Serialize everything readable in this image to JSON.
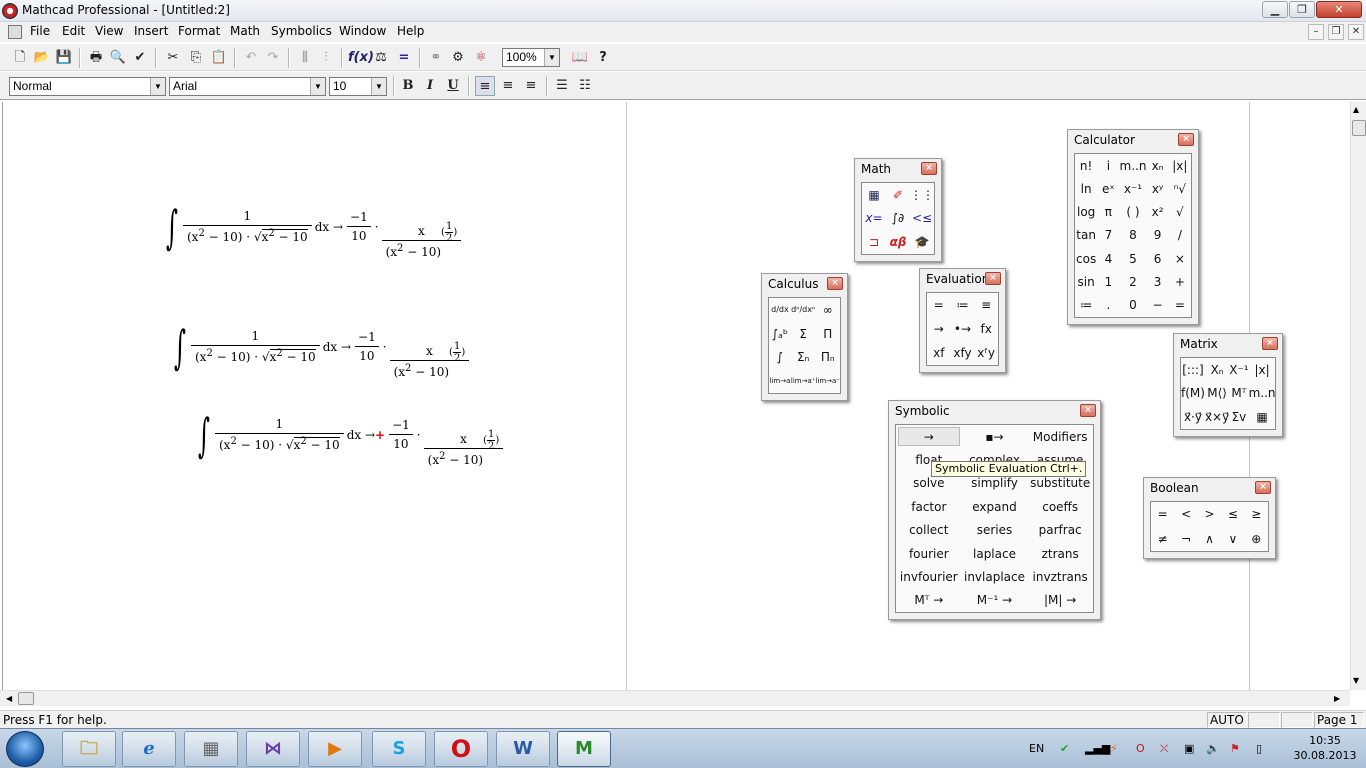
{
  "window": {
    "title": "Mathcad Professional - [Untitled:2]",
    "min": "▁",
    "max": "❐",
    "close": "✕",
    "mdi_min": "–",
    "mdi_max": "❐",
    "mdi_close": "✕"
  },
  "menu": [
    "File",
    "Edit",
    "View",
    "Insert",
    "Format",
    "Math",
    "Symbolics",
    "Window",
    "Help"
  ],
  "toolbar": {
    "zoom": "100%"
  },
  "format_bar": {
    "style": "Normal",
    "font": "Arial",
    "size": "10",
    "bold": "B",
    "italic": "I",
    "underline": "U"
  },
  "worksheet": {
    "expressions": [
      {
        "num": "1",
        "den_a": "x",
        "den_a_exp": "2",
        "den_b": " − 10",
        "dot": "·",
        "sqrt": "√",
        "rad_x": "x",
        "rad_exp": "2",
        "rad_rest": " − 10",
        "dx": "dx",
        "arrow": "→",
        "rnum": "−1",
        "rden": "10",
        "rdot": "·",
        "fnum": "x",
        "fden_x": "x",
        "fden_exp": "2",
        "fden_rest": " − 10",
        "pnum": "1",
        "pden": "2"
      },
      {
        "num": "1",
        "den_a": "x",
        "den_a_exp": "2",
        "den_b": " − 10",
        "dot": "·",
        "sqrt": "√",
        "rad_x": "x",
        "rad_exp": "2",
        "rad_rest": " − 10",
        "dx": "dx",
        "arrow": "→",
        "rnum": "−1",
        "rden": "10",
        "rdot": "·",
        "fnum": "x",
        "fden_x": "x",
        "fden_exp": "2",
        "fden_rest": " − 10",
        "pnum": "1",
        "pden": "2"
      },
      {
        "num": "1",
        "den_a": "x",
        "den_a_exp": "2",
        "den_b": " − 10",
        "dot": "·",
        "sqrt": "√",
        "rad_x": "x",
        "rad_exp": "2",
        "rad_rest": " − 10",
        "dx": "dx",
        "arrow": "→",
        "rnum": "−1",
        "rden": "10",
        "rdot": "·",
        "fnum": "x",
        "fden_x": "x",
        "fden_exp": "2",
        "fden_rest": " − 10",
        "pnum": "1",
        "pden": "2"
      }
    ]
  },
  "palettes": {
    "math": {
      "title": "Math",
      "close": "×",
      "items": [
        "▦",
        "✐",
        "⋮⋮",
        "x=",
        "∫∂",
        "<≤",
        "⊐",
        "αβ",
        "🎓"
      ]
    },
    "calculus": {
      "title": "Calculus",
      "close": "×",
      "items": [
        "d/dx",
        "dⁿ/dxⁿ",
        "∞",
        "∫ₐᵇ",
        "Σ",
        "Π",
        "∫",
        "Σₙ",
        "Πₙ",
        "lim→a",
        "lim→a⁺",
        "lim→a⁻"
      ]
    },
    "evaluation": {
      "title": "Evaluation",
      "close": "×",
      "items": [
        "=",
        "≔",
        "≡",
        "→",
        "•→",
        "fx",
        "xf",
        "xfy",
        "xᶠy"
      ]
    },
    "calculator": {
      "title": "Calculator",
      "close": "×",
      "items": [
        "n!",
        "i",
        "m..n",
        "xₙ",
        "|x|",
        "ln",
        "eˣ",
        "x⁻¹",
        "xʸ",
        "ⁿ√",
        "log",
        "π",
        "( )",
        "x²",
        "√",
        "tan",
        "7",
        "8",
        "9",
        "/",
        "cos",
        "4",
        "5",
        "6",
        "×",
        "sin",
        "1",
        "2",
        "3",
        "+",
        "≔",
        ".",
        "0",
        "−",
        "="
      ]
    },
    "matrix": {
      "title": "Matrix",
      "close": "×",
      "items": [
        "[:::]",
        "Xₙ",
        "X⁻¹",
        "|x|",
        "f(M)",
        "M⟨⟩",
        "Mᵀ",
        "m..n",
        "x⃗·y⃗",
        "x⃗×y⃗",
        "Σv",
        "▦"
      ]
    },
    "symbolic": {
      "title": "Symbolic",
      "close": "×",
      "items": [
        "→",
        "▪→",
        "Modifiers",
        "float",
        "complex",
        "assume",
        "solve",
        "simplify",
        "substitute",
        "factor",
        "expand",
        "coeffs",
        "collect",
        "series",
        "parfrac",
        "fourier",
        "laplace",
        "ztrans",
        "invfourier",
        "invlaplace",
        "invztrans",
        "Mᵀ →",
        "M⁻¹ →",
        "|M| →"
      ]
    },
    "boolean": {
      "title": "Boolean",
      "close": "×",
      "items": [
        "=",
        "<",
        ">",
        "≤",
        "≥",
        "≠",
        "¬",
        "∧",
        "∨",
        "⊕"
      ]
    }
  },
  "tooltip": "Symbolic Evaluation Ctrl+.",
  "status": {
    "help": "Press F1 for help.",
    "mode": "AUTO",
    "page": "Page 1"
  },
  "taskbar": {
    "lang": "EN",
    "time": "10:35",
    "date": "30.08.2013"
  }
}
